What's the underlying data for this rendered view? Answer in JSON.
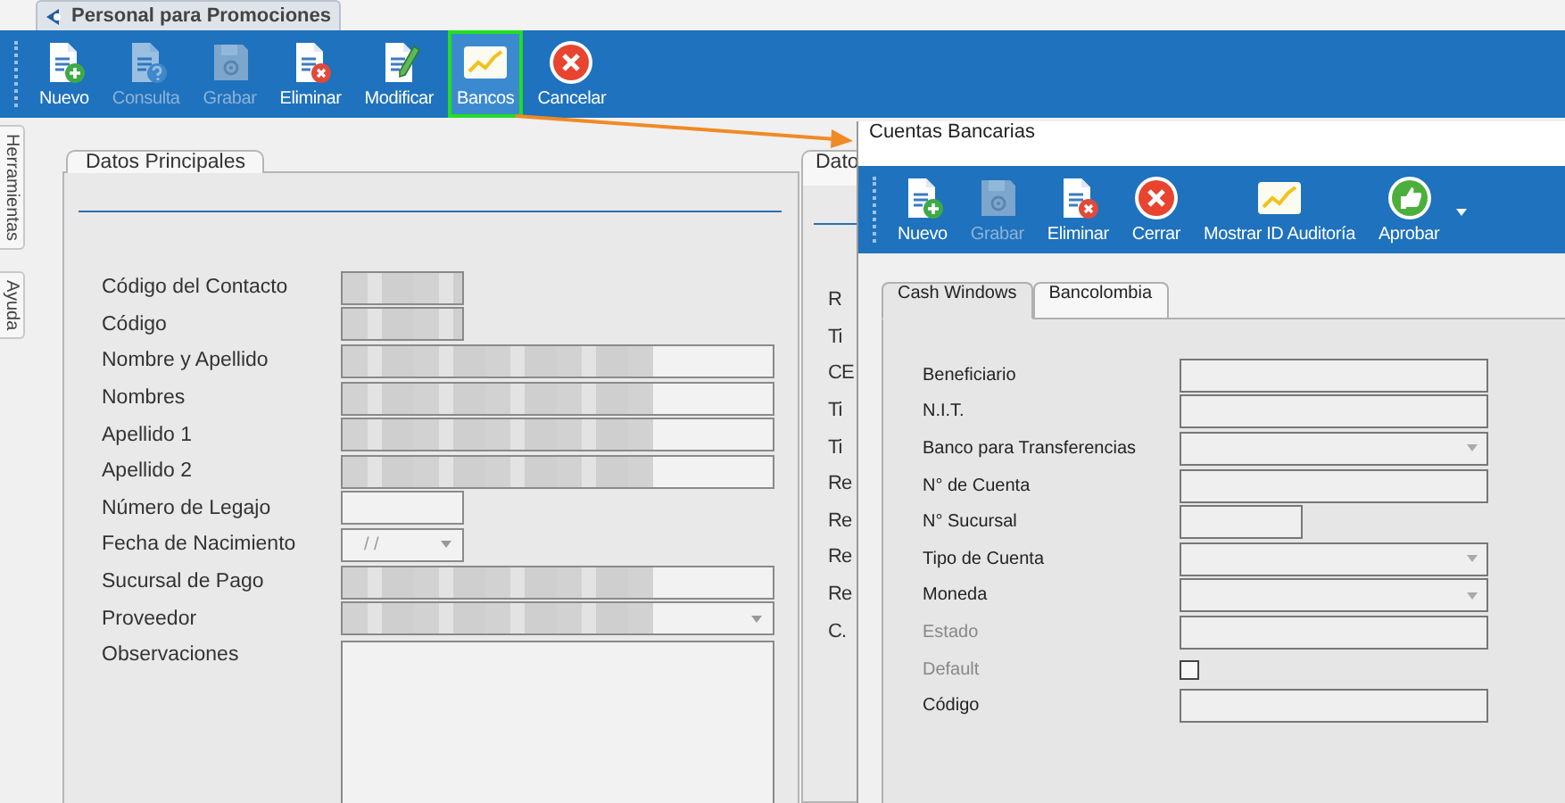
{
  "window": {
    "tab": "Personal para Promociones"
  },
  "toolbar": [
    {
      "label": "Nuevo",
      "disabled": false,
      "highlighted": false
    },
    {
      "label": "Consulta",
      "disabled": true,
      "highlighted": false
    },
    {
      "label": "Grabar",
      "disabled": true,
      "highlighted": false
    },
    {
      "label": "Eliminar",
      "disabled": false,
      "highlighted": false
    },
    {
      "label": "Modificar",
      "disabled": false,
      "highlighted": false
    },
    {
      "label": "Bancos",
      "disabled": false,
      "highlighted": true
    },
    {
      "label": "Cancelar",
      "disabled": false,
      "highlighted": false
    }
  ],
  "side_tabs": [
    "Herramientas",
    "Ayuda"
  ],
  "main_panel": {
    "tab": "Datos Principales",
    "fields": [
      {
        "label": "Código del Contacto",
        "kind": "short",
        "redacted": true
      },
      {
        "label": "Código",
        "kind": "short",
        "redacted": true
      },
      {
        "label": "Nombre y Apellido",
        "kind": "text",
        "redacted": true
      },
      {
        "label": "Nombres",
        "kind": "text",
        "redacted": true
      },
      {
        "label": "Apellido 1",
        "kind": "text",
        "redacted": true
      },
      {
        "label": "Apellido 2",
        "kind": "text",
        "redacted": true
      },
      {
        "label": "Número de Legajo",
        "kind": "short",
        "redacted": false
      },
      {
        "label": "Fecha de Nacimiento",
        "kind": "date",
        "redacted": false,
        "value": "/ /"
      },
      {
        "label": "Sucursal de Pago",
        "kind": "text",
        "redacted": true
      },
      {
        "label": "Proveedor",
        "kind": "combo",
        "redacted": true
      },
      {
        "label": "Observaciones",
        "kind": "memo",
        "redacted": false
      }
    ]
  },
  "second_panel": {
    "tab": "Dato",
    "labels": [
      "R",
      "Ti",
      "CE",
      "Ti",
      "Ti",
      "Re",
      "Re",
      "Re",
      "Re",
      "C."
    ]
  },
  "arrow_to_dialog": true,
  "dialog": {
    "title": "Cuentas Bancarias",
    "toolbar": [
      {
        "label": "Nuevo",
        "disabled": false,
        "menu": false
      },
      {
        "label": "Grabar",
        "disabled": true,
        "menu": false
      },
      {
        "label": "Eliminar",
        "disabled": false,
        "menu": false
      },
      {
        "label": "Cerrar",
        "disabled": false,
        "menu": false
      },
      {
        "label": "Mostrar ID Auditoría",
        "disabled": false,
        "menu": false
      },
      {
        "label": "Aprobar",
        "disabled": false,
        "menu": true
      }
    ],
    "tabs": [
      {
        "label": "Cash Windows",
        "selected": true
      },
      {
        "label": "Bancolombia",
        "selected": false
      }
    ],
    "fields": [
      {
        "label": "Beneficiario",
        "kind": "text",
        "disabled": false
      },
      {
        "label": "N.I.T.",
        "kind": "text",
        "disabled": false
      },
      {
        "label": "Banco para Transferencias",
        "kind": "combo",
        "disabled": false
      },
      {
        "label": "N° de Cuenta",
        "kind": "text",
        "disabled": false
      },
      {
        "label": "N° Sucursal",
        "kind": "short",
        "disabled": false
      },
      {
        "label": "Tipo de Cuenta",
        "kind": "combo",
        "disabled": false
      },
      {
        "label": "Moneda",
        "kind": "combo",
        "disabled": false
      },
      {
        "label": "Estado",
        "kind": "text",
        "disabled": true
      },
      {
        "label": "Default",
        "kind": "checkbox",
        "disabled": true,
        "checked": false
      },
      {
        "label": "Código",
        "kind": "text",
        "disabled": false
      }
    ]
  }
}
